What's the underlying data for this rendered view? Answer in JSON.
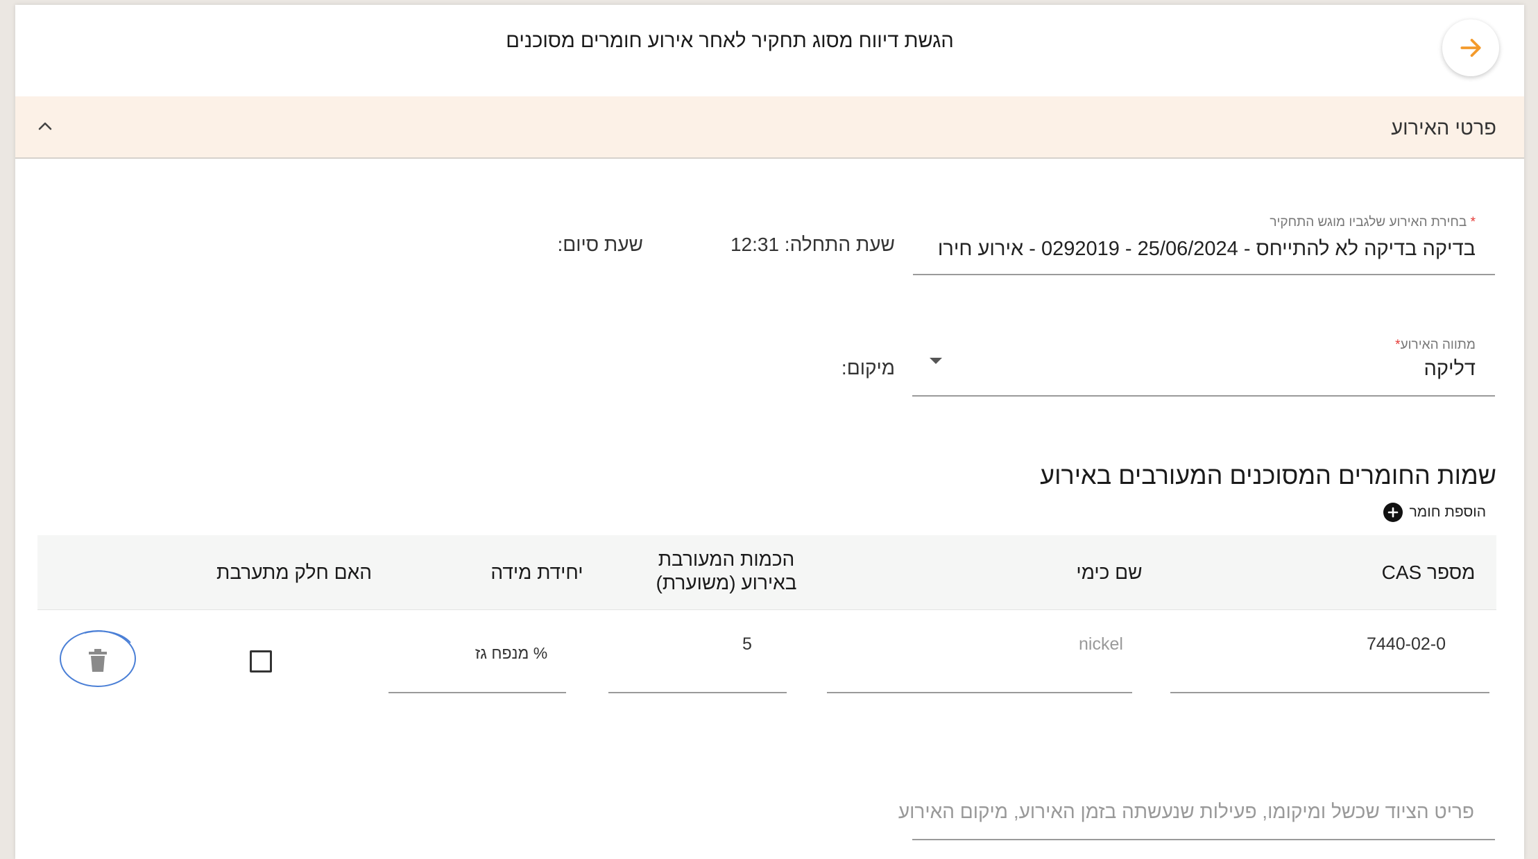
{
  "header": {
    "title": "הגשת דיווח מסוג תחקיר לאחר אירוע חומרים מסוכנים",
    "back_icon": "arrow-right-icon",
    "accent_color": "#f39a2b"
  },
  "section": {
    "title": "פרטי האירוע",
    "collapse_icon": "chevron-up-icon",
    "background": "#fcf1e7"
  },
  "event_select": {
    "label": "בחירת האירוע שלגביו מוגש התחקיר",
    "required_mark": "*",
    "value": "בדיקה בדיקה לא להתייחס - 25/06/2024 - 0292019 - אירוע חירו"
  },
  "times": {
    "start": "שעת התחלה: 12:31",
    "end": "שעת סיום:"
  },
  "scenario": {
    "label": "מתווה האירוע",
    "required_mark": "*",
    "value": "דליקה"
  },
  "location": {
    "label": "מיקום:"
  },
  "materials": {
    "heading": "שמות החומרים המסוכנים המעורבים באירוע",
    "add_label": "הוספת חומר",
    "columns": {
      "cas": "מספר CAS",
      "chem_name": "שם כימי",
      "quantity": "הכמות המעורבת באירוע (משוערת)",
      "unit": "יחידת מידה",
      "intervention": "האם חלק מתערבת"
    },
    "rows": [
      {
        "cas": "7440-02-0",
        "chem_name": "nickel",
        "quantity": "5",
        "unit": "% מנפח גז",
        "intervention": false
      }
    ]
  },
  "description": {
    "placeholder": "פריט הציוד שכשל ומיקומו, פעילות שנעשתה בזמן האירוע, מיקום האירוע"
  }
}
